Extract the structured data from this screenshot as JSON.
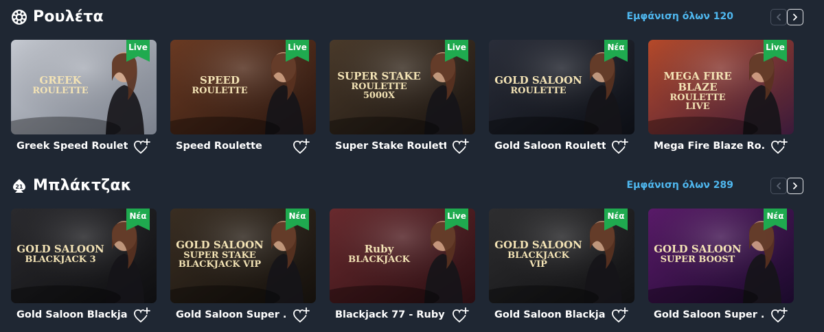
{
  "sections": [
    {
      "id": "roulette",
      "title": "Ρουλέτα",
      "icon": "roulette-wheel-icon",
      "view_all": "Εμφάνιση όλων 120",
      "games": [
        {
          "name": "Greek Speed Roulett...",
          "badge": "Live",
          "logo": "GREEK\nROULETTE",
          "palette": [
            "#c8ccd4",
            "#7a808c"
          ]
        },
        {
          "name": "Speed Roulette",
          "badge": "Live",
          "logo": "SPEED\nROULETTE",
          "palette": [
            "#6b3a22",
            "#2a1710"
          ]
        },
        {
          "name": "Super Stake Roulette",
          "badge": "Live",
          "logo": "SUPER STAKE\nROULETTE\n5000X",
          "palette": [
            "#4a3a2a",
            "#1a1410"
          ]
        },
        {
          "name": "Gold Saloon Roulette",
          "badge": "Νέα",
          "logo": "GOLD SALOON\nROULETTE",
          "palette": [
            "#2a2e3a",
            "#0c0e14"
          ]
        },
        {
          "name": "Mega Fire Blaze Ro...",
          "badge": "Live",
          "logo": "MEGA FIRE BLAZE\nROULETTE\nLIVE",
          "palette": [
            "#b84a2a",
            "#3a1a3a"
          ]
        }
      ]
    },
    {
      "id": "blackjack",
      "title": "Μπλάκτζακ",
      "icon": "blackjack-chip-icon",
      "view_all": "Εμφάνιση όλων 289",
      "games": [
        {
          "name": "Gold Saloon Blackja...",
          "badge": "Νέα",
          "logo": "GOLD SALOON\nBLACKJACK 3",
          "palette": [
            "#2a2a2e",
            "#0e0e10"
          ]
        },
        {
          "name": "Gold Saloon Super ...",
          "badge": "Νέα",
          "logo": "GOLD SALOON\nSUPER STAKE\nBLACKJACK VIP",
          "palette": [
            "#3a2e22",
            "#14100c"
          ]
        },
        {
          "name": "Blackjack 77 - Ruby",
          "badge": "Live",
          "logo": "Ruby\nBLACKJACK",
          "palette": [
            "#6a2a2e",
            "#2a0e12"
          ]
        },
        {
          "name": "Gold Saloon Blackja...",
          "badge": "Νέα",
          "logo": "GOLD SALOON\nBLACKJACK\nVIP",
          "palette": [
            "#2e2e30",
            "#101012"
          ]
        },
        {
          "name": "Gold Saloon Super ...",
          "badge": "Νέα",
          "logo": "GOLD SALOON\nSUPER BOOST",
          "palette": [
            "#5a1a6a",
            "#1a0a2a"
          ]
        }
      ]
    }
  ],
  "colors": {
    "background": "#1f2733",
    "accent_link": "#4fb8f0",
    "badge_green": "#1faa4f"
  }
}
